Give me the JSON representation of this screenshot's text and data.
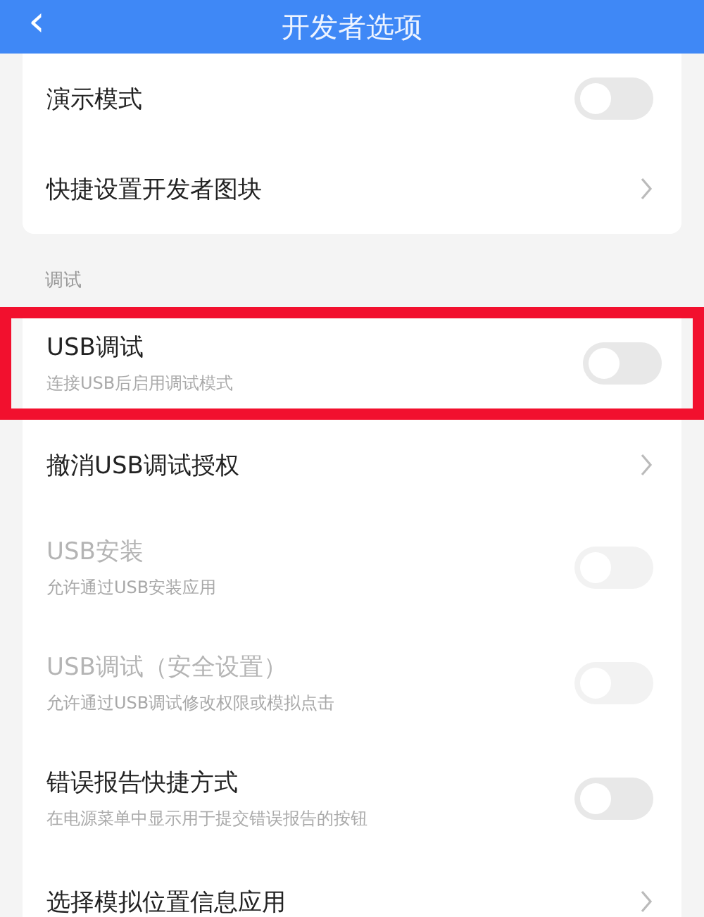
{
  "header": {
    "back_icon": "‹",
    "title": "开发者选项"
  },
  "groups": [
    {
      "rows": [
        {
          "kind": "toggle",
          "title": "演示模式",
          "on": false,
          "disabled": false,
          "highlighted": false
        },
        {
          "kind": "link",
          "title": "快捷设置开发者图块",
          "disabled": false,
          "highlighted": false
        }
      ]
    },
    {
      "label": "调试",
      "rows": [
        {
          "kind": "toggle",
          "title": "USB调试",
          "subtitle": "连接USB后启用调试模式",
          "on": false,
          "disabled": false,
          "highlighted": true
        },
        {
          "kind": "link",
          "title": "撤消USB调试授权",
          "disabled": false,
          "highlighted": false
        },
        {
          "kind": "toggle",
          "title": "USB安装",
          "subtitle": "允许通过USB安装应用",
          "on": false,
          "disabled": true,
          "highlighted": false
        },
        {
          "kind": "toggle",
          "title": "USB调试（安全设置）",
          "subtitle": "允许通过USB调试修改权限或模拟点击",
          "on": false,
          "disabled": true,
          "highlighted": false
        },
        {
          "kind": "toggle",
          "title": "错误报告快捷方式",
          "subtitle": "在电源菜单中显示用于提交错误报告的按钮",
          "on": false,
          "disabled": false,
          "highlighted": false
        },
        {
          "kind": "link",
          "title": "选择模拟位置信息应用",
          "disabled": false,
          "highlighted": false
        }
      ]
    }
  ]
}
